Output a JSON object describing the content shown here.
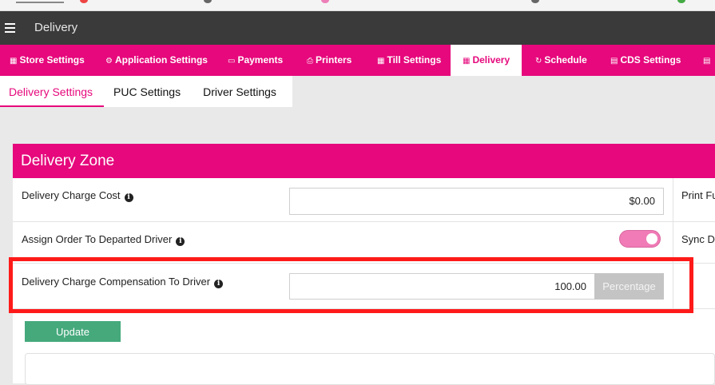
{
  "app": {
    "title": "Delivery"
  },
  "nav": {
    "items": [
      {
        "label": "Store Settings",
        "icon": "store-icon",
        "glyph": "▦"
      },
      {
        "label": "Application Settings",
        "icon": "cogs-icon",
        "glyph": "⚙"
      },
      {
        "label": "Payments",
        "icon": "money-icon",
        "glyph": "▭"
      },
      {
        "label": "Printers",
        "icon": "printer-icon",
        "glyph": "⎙"
      },
      {
        "label": "Till Settings",
        "icon": "till-icon",
        "glyph": "▦"
      },
      {
        "label": "Delivery",
        "icon": "delivery-icon",
        "glyph": "▦"
      },
      {
        "label": "Schedule",
        "icon": "refresh-icon",
        "glyph": "↻"
      },
      {
        "label": "CDS Settings",
        "icon": "display-icon",
        "glyph": "▤"
      },
      {
        "label": "",
        "icon": "display-icon",
        "glyph": "▤"
      }
    ],
    "active_color": "#e6087c"
  },
  "subtabs": [
    "Delivery Settings",
    "PUC Settings",
    "Driver Settings"
  ],
  "panel": {
    "title": "Delivery Zone",
    "rows": [
      {
        "label": "Delivery Charge Cost",
        "value": "$0.00",
        "right_label": "Print Fu"
      },
      {
        "label": "Assign Order To Departed Driver",
        "toggle_on": true,
        "right_label": "Sync D"
      },
      {
        "label": "Delivery Charge Compensation To Driver",
        "value": "100.00",
        "addon": "Percentage"
      }
    ]
  },
  "actions": {
    "update_label": "Update"
  },
  "colors": {
    "brand": "#e6087c",
    "button": "#45a97c",
    "highlight": "#ff1a1a"
  }
}
